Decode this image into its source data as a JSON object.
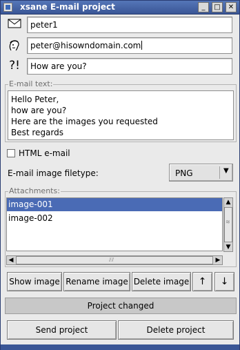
{
  "window": {
    "title": "xsane E-mail project",
    "controls": {
      "minimize": "_",
      "maximize": "□",
      "close": "✕"
    }
  },
  "fields": {
    "receiver": {
      "icon": "envelope-icon",
      "value": "peter1"
    },
    "email": {
      "icon": "face-icon",
      "value": "peter@hisowndomain.com"
    },
    "subject": {
      "icon": "question-exclamation-icon",
      "icon_text": "?!",
      "value": "How are you?"
    }
  },
  "email_text": {
    "label": "E-mail text:",
    "lines": [
      "Hello Peter,",
      "how are you?",
      "Here are the images you requested",
      "Best regards"
    ]
  },
  "html_email": {
    "label": "HTML e-mail",
    "checked": false
  },
  "filetype": {
    "label": "E-mail image filetype:",
    "value": "PNG"
  },
  "attachments": {
    "label": "Attachments:",
    "items": [
      {
        "name": "image-001",
        "selected": true
      },
      {
        "name": "image-002",
        "selected": false
      }
    ]
  },
  "buttons": {
    "show_image": "Show image",
    "rename_image": "Rename image",
    "delete_image": "Delete image",
    "move_up": "↑",
    "move_down": "↓",
    "send_project": "Send project",
    "delete_project": "Delete project"
  },
  "status": {
    "text": "Project changed"
  },
  "colors": {
    "titlebar": "#3a5696",
    "selection": "#4a6bb5",
    "background": "#eaeaea"
  }
}
